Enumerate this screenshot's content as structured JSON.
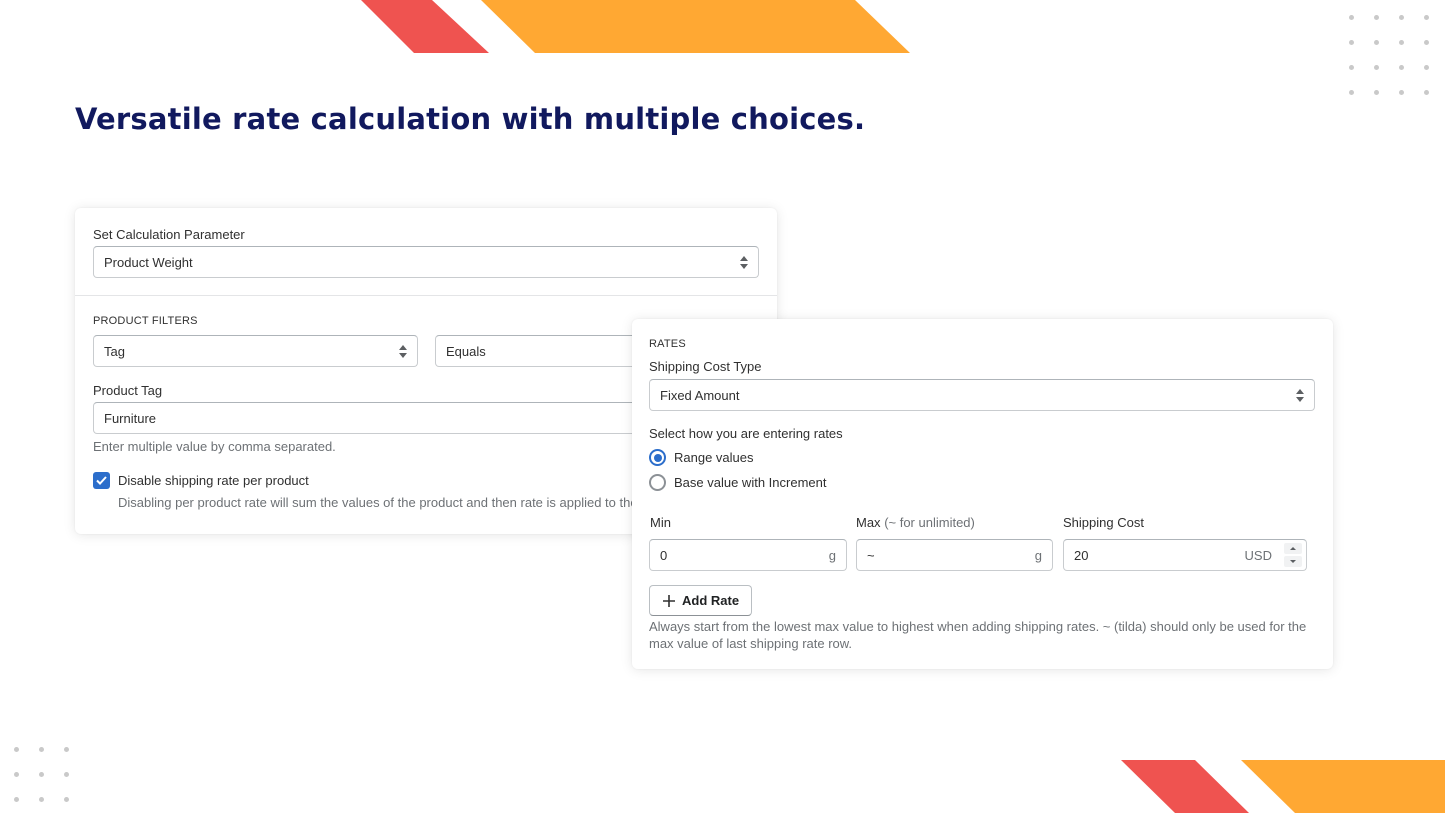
{
  "headline": "Versatile rate calculation with multiple choices.",
  "colors": {
    "accent_red": "#ef5350",
    "accent_orange": "#ffa833",
    "headline": "#11195e",
    "primary_blue": "#2c6ecb"
  },
  "calc_card": {
    "param_label": "Set Calculation Parameter",
    "param_value": "Product Weight",
    "filters_heading": "PRODUCT FILTERS",
    "filter_type_value": "Tag",
    "filter_condition_value": "Equals",
    "product_tag_label": "Product Tag",
    "product_tag_value": "Furniture",
    "product_tag_help": "Enter multiple value by comma separated.",
    "disable_checkbox_label": "Disable shipping rate per product",
    "disable_checkbox_checked": true,
    "disable_help": "Disabling per product rate will sum the values of the product and then rate is applied to the su"
  },
  "rates_card": {
    "heading": "RATES",
    "cost_type_label": "Shipping Cost Type",
    "cost_type_value": "Fixed Amount",
    "entry_mode_label": "Select how you are entering rates",
    "entry_modes": [
      {
        "label": "Range values",
        "selected": true
      },
      {
        "label": "Base value with Increment",
        "selected": false
      }
    ],
    "min_label": "Min",
    "max_label": "Max",
    "max_hint": "(~ for unlimited)",
    "cost_label": "Shipping Cost",
    "min_value": "0",
    "min_unit": "g",
    "max_value": "~",
    "max_unit": "g",
    "cost_value": "20",
    "cost_currency": "USD",
    "add_rate_label": "Add Rate",
    "footer_help": "Always start from the lowest max value to highest when adding shipping rates. ~ (tilda) should only be used for the max value of last shipping rate row."
  }
}
